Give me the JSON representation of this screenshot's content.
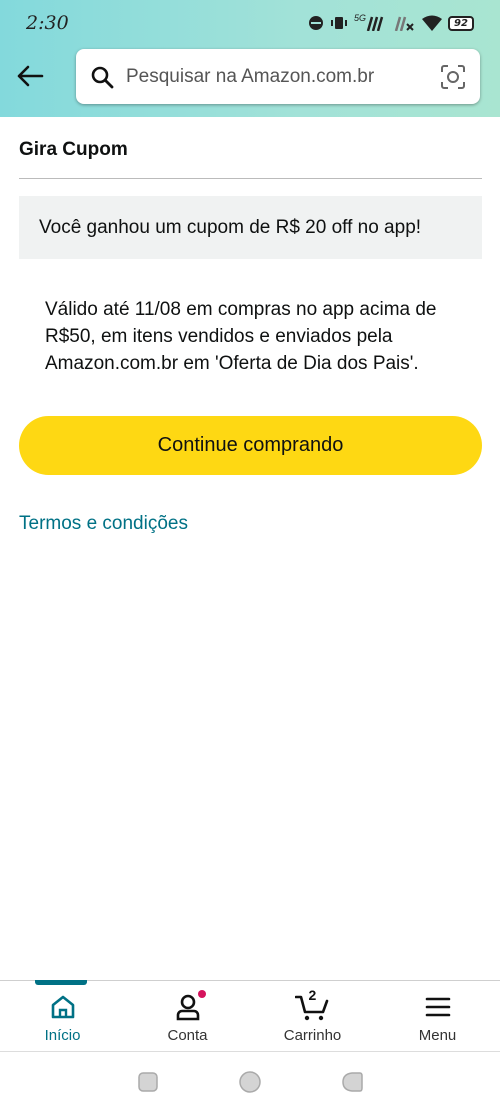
{
  "status_bar": {
    "time": "2:30",
    "network_label": "5G",
    "battery": "92"
  },
  "header": {
    "search_placeholder": "Pesquisar na Amazon.com.br"
  },
  "page": {
    "title": "Gira Cupom",
    "banner_text": "Você ganhou um cupom de R$ 20 off no app!",
    "details_text": "Válido até 11/08 em compras no app acima de R$50, em itens vendidos e enviados pela Amazon.com.br em 'Oferta de Dia dos Pais'.",
    "continue_label": "Continue comprando",
    "terms_label": "Termos e condições"
  },
  "bottom_nav": {
    "items": [
      {
        "label": "Início",
        "icon": "home-icon",
        "active": true
      },
      {
        "label": "Conta",
        "icon": "account-icon",
        "active": false
      },
      {
        "label": "Carrinho",
        "icon": "cart-icon",
        "active": false,
        "count": "2"
      },
      {
        "label": "Menu",
        "icon": "menu-icon",
        "active": false
      }
    ]
  },
  "colors": {
    "accent_teal": "#007185",
    "button_yellow": "#fed813",
    "header_gradient_start": "#83d9dc",
    "header_gradient_end": "#a9e5d1",
    "notification_dot": "#d5135d"
  }
}
